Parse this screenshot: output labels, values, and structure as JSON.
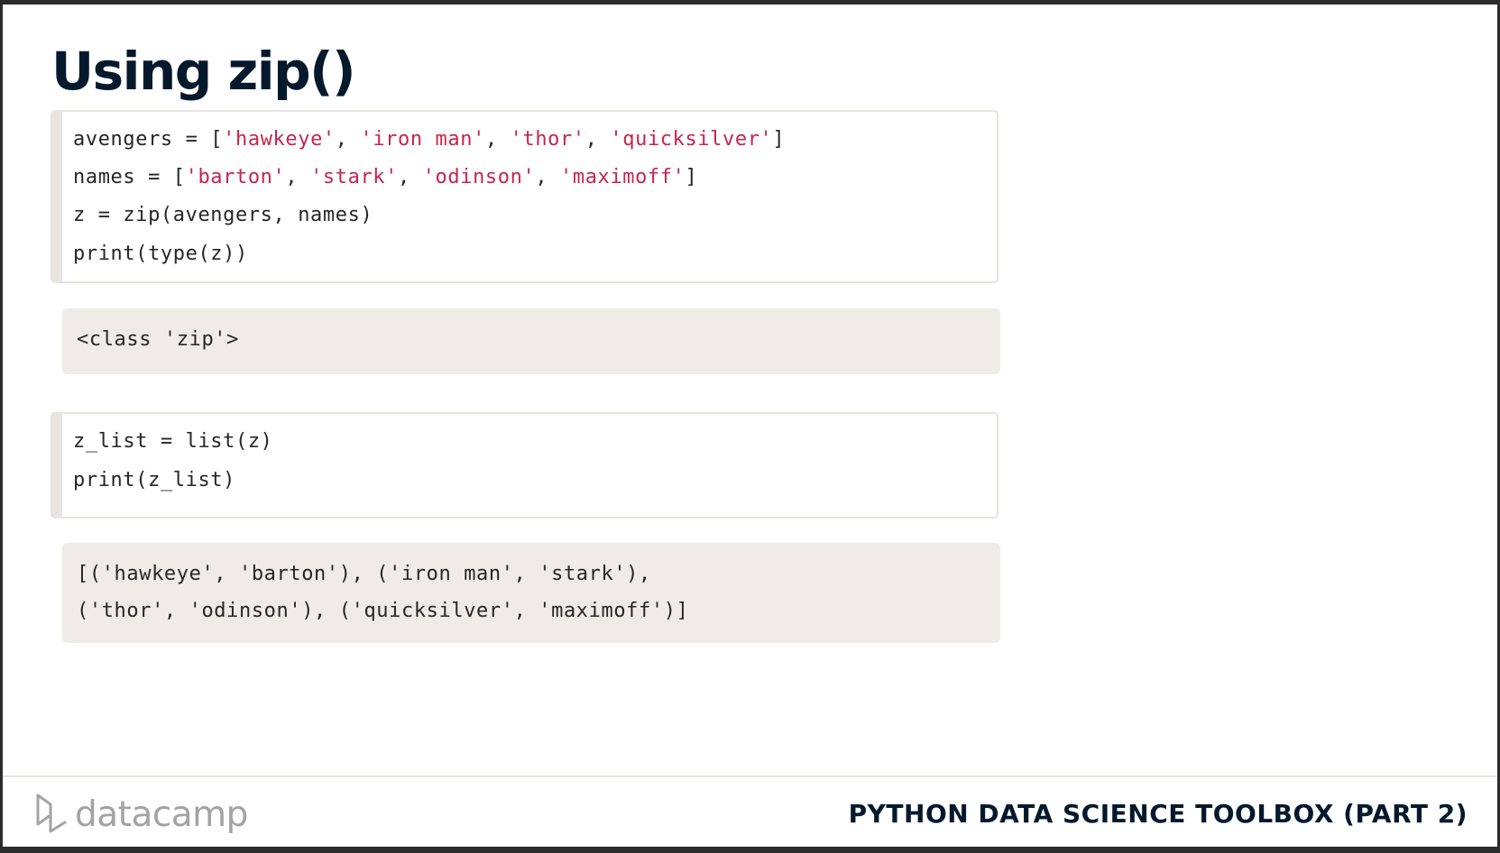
{
  "slide": {
    "title": "Using zip()"
  },
  "code_block_1": {
    "line1": {
      "p1": "avengers = [",
      "s1": "'hawkeye'",
      "p2": ", ",
      "s2": "'iron man'",
      "p3": ", ",
      "s3": "'thor'",
      "p4": ", ",
      "s4": "'quicksilver'",
      "p5": "]"
    },
    "line2": {
      "p1": "names = [",
      "s1": "'barton'",
      "p2": ", ",
      "s2": "'stark'",
      "p3": ", ",
      "s3": "'odinson'",
      "p4": ", ",
      "s4": "'maximoff'",
      "p5": "]"
    },
    "line3": "z = zip(avengers, names)",
    "line4": "print(type(z))"
  },
  "output_block_1": {
    "line1": "<class 'zip'>"
  },
  "code_block_2": {
    "line1": "z_list = list(z)",
    "line2": "print(z_list)"
  },
  "output_block_2": {
    "line1": "[('hawkeye', 'barton'), ('iron man', 'stark'),",
    "line2": "('thor', 'odinson'), ('quicksilver', 'maximoff')]"
  },
  "footer": {
    "logo_text": "datacamp",
    "logo_icon": "datacamp-logo-icon",
    "course_title": "PYTHON DATA SCIENCE TOOLBOX (PART 2)"
  },
  "colors": {
    "title": "#05192d",
    "string": "#c7254e",
    "output_bg": "#efebe6",
    "code_border": "#e8e5e0"
  }
}
